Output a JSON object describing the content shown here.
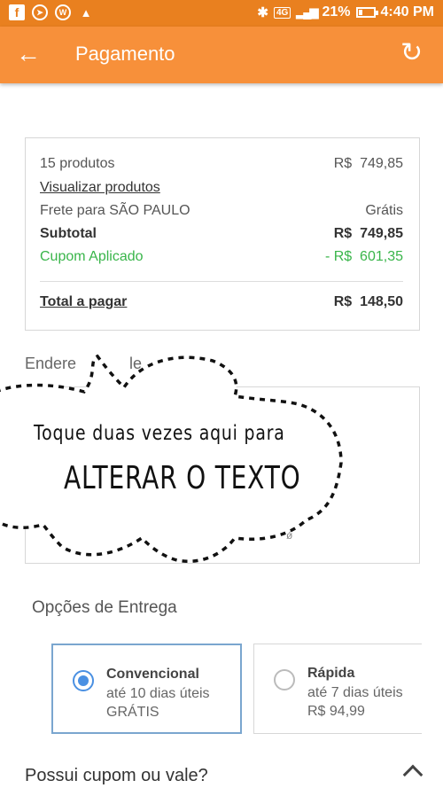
{
  "status_bar": {
    "time": "4:40 PM",
    "battery": "21%",
    "network": "4G",
    "icons": [
      "facebook-icon",
      "telegram-icon",
      "vpn-icon",
      "warning-icon",
      "bluetooth-icon",
      "signal-icon",
      "battery-icon"
    ]
  },
  "app_bar": {
    "title": "Pagamento",
    "back_icon": "arrow-left-icon",
    "refresh_icon": "refresh-icon",
    "background": "#f7903a"
  },
  "summary": {
    "products_label": "15 produtos",
    "products_value": "R$  749,85",
    "view_products": "Visualizar produtos",
    "shipping_label": "Frete para SÃO PAULO",
    "shipping_value": "Grátis",
    "subtotal_label": "Subtotal",
    "subtotal_value": "R$  749,85",
    "coupon_label": "Cupom Aplicado",
    "coupon_value": "- R$  601,35",
    "total_label": "Total a pagar",
    "total_value": "R$  148,50",
    "coupon_color": "#39b54a"
  },
  "address": {
    "title": "Endere",
    "title_tail": "le",
    "fragment": "ǿ"
  },
  "overlay": {
    "line1": "Toque duas vezes aqui para",
    "line2": "ALTERAR O TEXTO"
  },
  "delivery": {
    "title": "Opções de Entrega",
    "options": [
      {
        "name": "Convencional",
        "eta": "até 10 dias úteis",
        "price": "GRÁTIS",
        "selected": true
      },
      {
        "name": "Rápida",
        "eta": "até 7 dias úteis",
        "price": "R$ 94,99",
        "selected": false
      }
    ]
  },
  "coupon_section": {
    "question": "Possui cupom ou vale?",
    "chevron_icon": "chevron-up-icon"
  }
}
